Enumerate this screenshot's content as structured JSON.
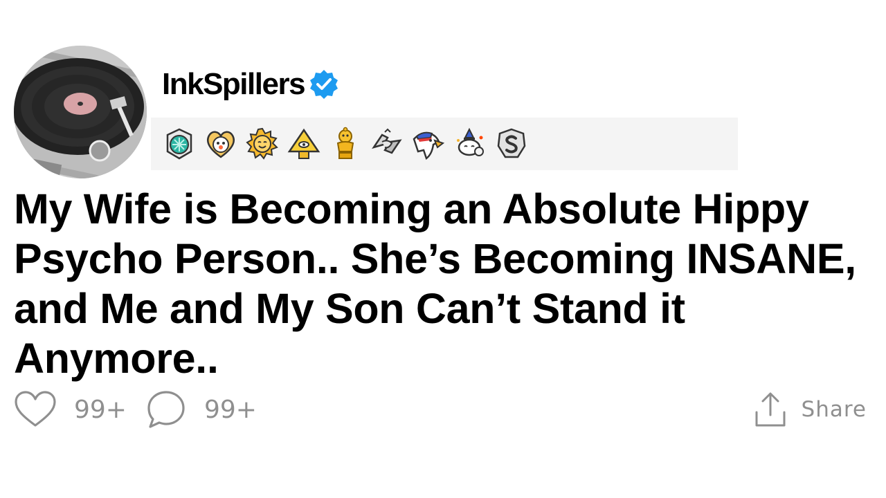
{
  "post": {
    "username": "InkSpillers",
    "verified": true,
    "title": "My Wife is Becoming an Absolute Hippy Psycho Person.. She’s Becoming INSANE, and Me and My Son Can’t Stand it Anymore..",
    "likes": "99+",
    "comments": "99+",
    "share_label": "Share"
  },
  "awards": [
    {
      "icon": "helpful-award-icon"
    },
    {
      "icon": "wholesome-award-icon"
    },
    {
      "icon": "sunny-face-award-icon"
    },
    {
      "icon": "pyramid-eye-award-icon"
    },
    {
      "icon": "gold-trophy-award-icon"
    },
    {
      "icon": "handshake-award-icon"
    },
    {
      "icon": "eagle-award-icon"
    },
    {
      "icon": "snoo-party-award-icon"
    },
    {
      "icon": "silver-s-award-icon"
    }
  ],
  "colors": {
    "verified_blue": "#1d9bf0",
    "muted_gray": "#8f8f8f",
    "awards_bg": "#f4f4f4",
    "text": "#000000"
  }
}
